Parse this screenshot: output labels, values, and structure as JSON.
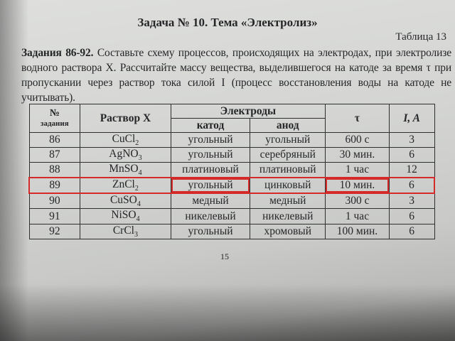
{
  "document": {
    "title": "Задача № 10. Тема «Электролиз»",
    "table_label": "Таблица 13",
    "intro_bold": "Задания 86-92.",
    "intro_text": " Составьте схему процессов, происходящих на электродах, при электролизе водного раствора Х. Рассчитайте массу вещества, выделившегося на катоде за время τ при пропускании через раствор тока силой I (процесс восстановления воды на катоде не учитывать).",
    "page_number": "15"
  },
  "table": {
    "headers": {
      "num_main": "№",
      "num_sub": "задания",
      "solution": "Раствор Х",
      "electrodes": "Электроды",
      "cathode": "катод",
      "anode": "анод",
      "time": "τ",
      "current": "I, A"
    },
    "rows": [
      {
        "num": "86",
        "formula": "CuCl",
        "sub": "2",
        "cathode": "угольный",
        "anode": "угольный",
        "time": "600 с",
        "current": "3"
      },
      {
        "num": "87",
        "formula": "AgNO",
        "sub": "3",
        "cathode": "угольный",
        "anode": "серебряный",
        "time": "30 мин.",
        "current": "6"
      },
      {
        "num": "88",
        "formula": "MnSO",
        "sub": "4",
        "cathode": "платиновый",
        "anode": "платиновый",
        "time": "1 час",
        "current": "12"
      },
      {
        "num": "89",
        "formula": "ZnCl",
        "sub": "2",
        "cathode": "угольный",
        "anode": "цинковый",
        "time": "10 мин.",
        "current": "6"
      },
      {
        "num": "90",
        "formula": "CuSO",
        "sub": "4",
        "cathode": "медный",
        "anode": "медный",
        "time": "300 с",
        "current": "3"
      },
      {
        "num": "91",
        "formula": "NiSO",
        "sub": "4",
        "cathode": "никелевый",
        "anode": "никелевый",
        "time": "1 час",
        "current": "6"
      },
      {
        "num": "92",
        "formula": "CrCl",
        "sub": "3",
        "cathode": "угольный",
        "anode": "хромовый",
        "time": "100 мин.",
        "current": "6"
      }
    ],
    "highlight_color": "#d42a2a"
  }
}
